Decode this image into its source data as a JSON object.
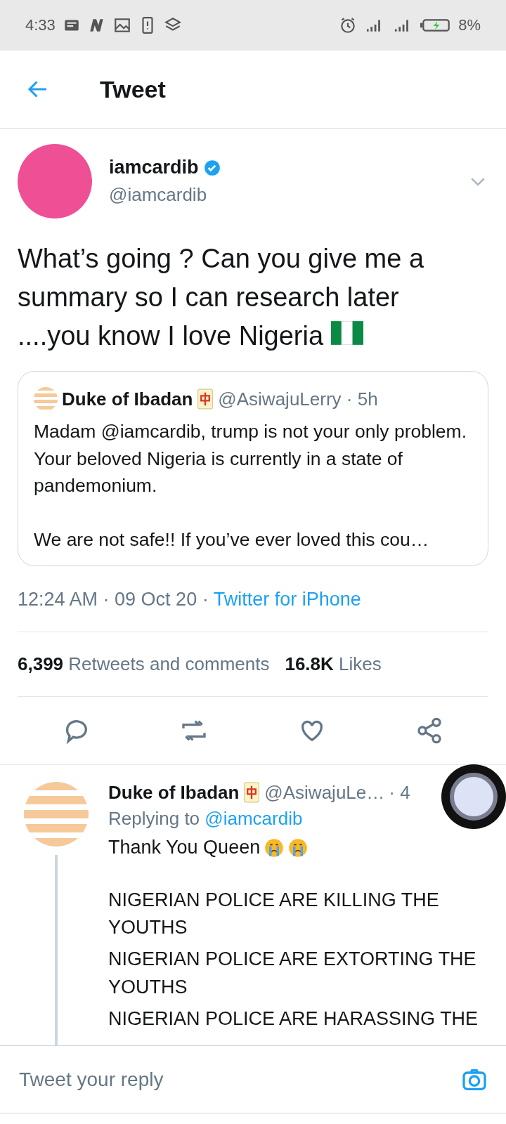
{
  "status_bar": {
    "time": "4:33",
    "battery": "8%"
  },
  "header": {
    "title": "Tweet"
  },
  "tweet": {
    "name": "iamcardib",
    "verified": true,
    "handle": "@iamcardib",
    "text": "What’s going ? Can you give me a summary so I can research later ....you know I love Nigeria",
    "quote": {
      "name": "Duke of Ibadan",
      "handle": "@AsiwajuLerry · 5h",
      "paragraphs": [
        "Madam @iamcardib, trump is not your only problem. Your beloved Nigeria is currently in a state of pandemonium.",
        "We are not safe!! If you’ve ever loved this cou…"
      ]
    },
    "timestamp": "12:24 AM · 09 Oct 20 · ",
    "source": "Twitter for iPhone",
    "stats": [
      {
        "count": "6,399",
        "label": "Retweets and comments"
      },
      {
        "count": "16.8K",
        "label": "Likes"
      }
    ],
    "actions": [
      {
        "kind": "reply"
      },
      {
        "kind": "retweet"
      },
      {
        "kind": "like"
      },
      {
        "kind": "share"
      }
    ]
  },
  "reply": {
    "name": "Duke of Ibadan",
    "handle": "@AsiwajuLe…",
    "time": "· 4",
    "replying_prefix": "Replying to",
    "replying_to": "@iamcardib",
    "greeting": "Thank You Queen",
    "lines": [
      "NIGERIAN POLICE ARE KILLING THE YOUTHS",
      "NIGERIAN POLICE ARE EXTORTING THE YOUTHS",
      "NIGERIAN POLICE ARE HARASSING THE"
    ]
  },
  "composer": {
    "placeholder": "Tweet your reply"
  }
}
